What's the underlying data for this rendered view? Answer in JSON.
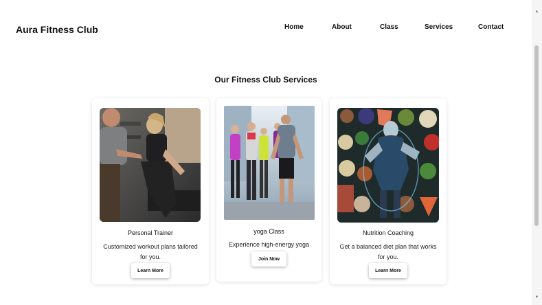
{
  "brand": {
    "name": "Aura Fitness Club"
  },
  "nav": {
    "home": "Home",
    "about": "About",
    "class": "Class",
    "services": "Services",
    "contact": "Contact"
  },
  "section": {
    "title": "Our Fitness Club Services"
  },
  "cards": [
    {
      "title": "Personal Trainer",
      "description": "Customized workout plans tailored for you.",
      "button": "Learn More"
    },
    {
      "title": "yoga Class",
      "description": "Experience high-energy yoga class.",
      "button": "Join Now"
    },
    {
      "title": "Nutrition Coaching",
      "description": "Get a balanced diet plan that works for you.",
      "button": "Learn More"
    }
  ],
  "colors": {
    "background": "#ffffff",
    "text": "#111111",
    "card_shadow": "#dddddd",
    "scroll_thumb": "#c2c2c2"
  },
  "icons": {
    "scroll_up": "triangle-up",
    "scroll_down": "triangle-down"
  }
}
